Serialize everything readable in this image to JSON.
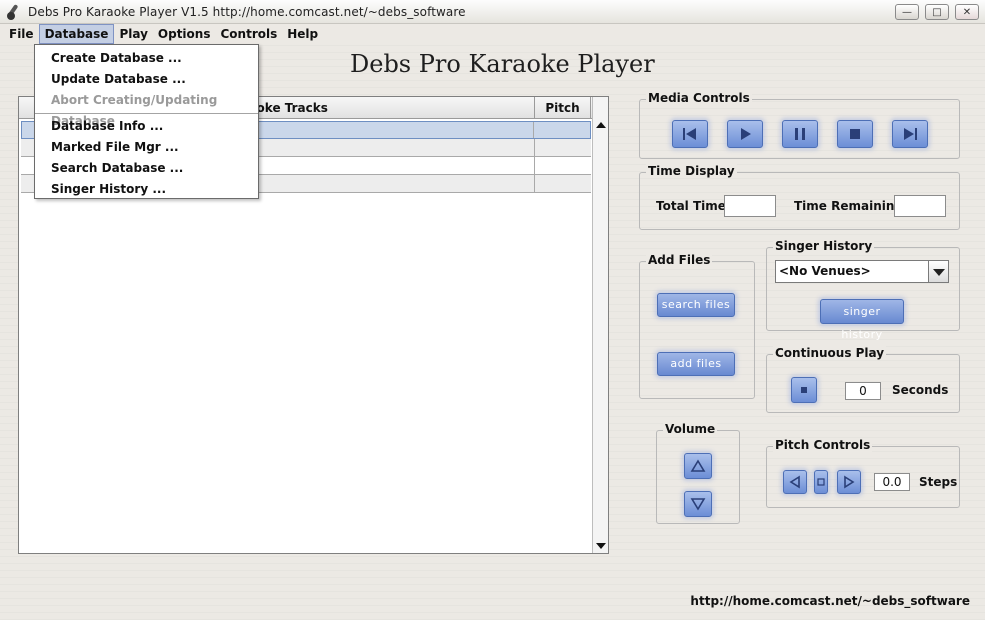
{
  "window": {
    "title": "Debs Pro Karaoke Player  V1.5  http://home.comcast.net/~debs_software",
    "minimize_glyph": "—",
    "maximize_glyph": "□",
    "close_glyph": "✕"
  },
  "menubar": {
    "items": [
      {
        "label": "File"
      },
      {
        "label": "Database",
        "active": true
      },
      {
        "label": "Play"
      },
      {
        "label": "Options"
      },
      {
        "label": "Controls"
      },
      {
        "label": "Help"
      }
    ]
  },
  "database_menu": {
    "items": [
      {
        "label": "Create Database ...",
        "enabled": true
      },
      {
        "label": "Update Database ...",
        "enabled": true
      },
      {
        "label": "Abort Creating/Updating Database",
        "enabled": false
      },
      {
        "label": "Database Info ...",
        "enabled": true
      },
      {
        "label": "Marked File Mgr ...",
        "enabled": true
      },
      {
        "label": "Search Database ...",
        "enabled": true
      },
      {
        "label": "Singer History ...",
        "enabled": true
      }
    ]
  },
  "app_title": "Debs Pro Karaoke Player",
  "track_table": {
    "columns": [
      "Karaoke Tracks",
      "Pitch"
    ],
    "rows": [
      {
        "track": "",
        "pitch": ""
      },
      {
        "track": "",
        "pitch": ""
      },
      {
        "track": "",
        "pitch": ""
      },
      {
        "track": "",
        "pitch": ""
      }
    ]
  },
  "media_controls": {
    "label": "Media Controls",
    "buttons": [
      "skip-back-icon",
      "play-icon",
      "pause-icon",
      "stop-icon",
      "skip-forward-icon"
    ]
  },
  "time_display": {
    "label": "Time Display",
    "total_time_label": "Total Time",
    "total_time_value": "",
    "time_remaining_label": "Time Remaining",
    "time_remaining_value": ""
  },
  "add_files": {
    "label": "Add Files",
    "search_button": "search files",
    "add_button": "add files"
  },
  "singer_history": {
    "label": "Singer History",
    "selected_venue": "<No Venues>",
    "button": "singer history"
  },
  "continuous_play": {
    "label": "Continuous Play",
    "seconds_value": "0",
    "seconds_label": "Seconds"
  },
  "volume": {
    "label": "Volume"
  },
  "pitch_controls": {
    "label": "Pitch Controls",
    "steps_value": "0.0",
    "steps_label": "Steps"
  },
  "footer_url": "http://home.comcast.net/~debs_software",
  "colors": {
    "accent_button": "#6c8ed6",
    "selection": "#cad7ea",
    "window_bg": "#ece9e4"
  }
}
